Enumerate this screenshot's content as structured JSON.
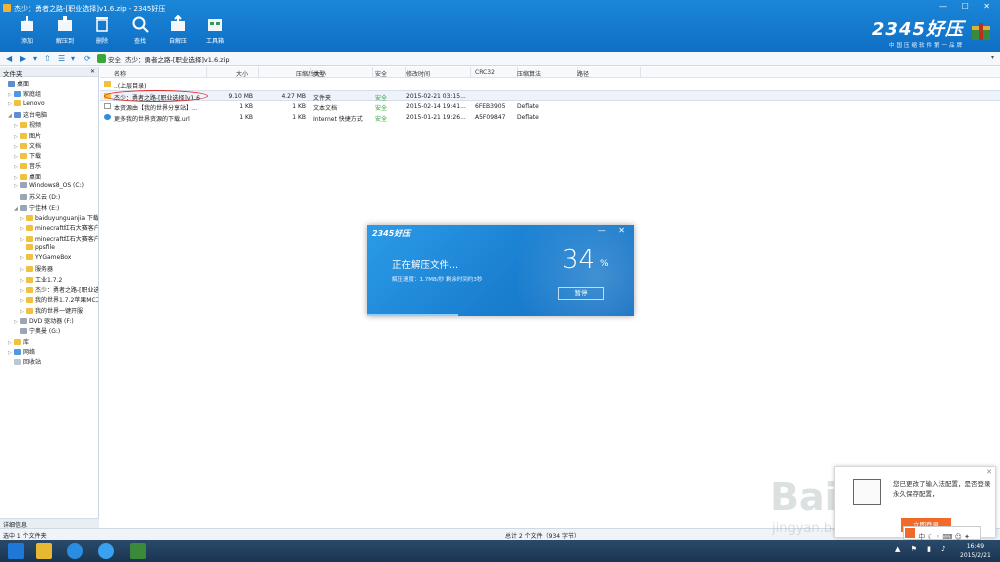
{
  "window": {
    "title": "杰少：勇者之路-[职业选择]v1.6.zip - 2345好压",
    "controls": "— ☐ ✕"
  },
  "toolbar": {
    "buttons": [
      {
        "label": "添加",
        "icon": "add-icon"
      },
      {
        "label": "解压到",
        "icon": "extract-icon"
      },
      {
        "label": "删除",
        "icon": "delete-icon"
      },
      {
        "label": "查找",
        "icon": "search-icon"
      },
      {
        "label": "自解压",
        "icon": "self-extract-icon"
      },
      {
        "label": "工具箱",
        "icon": "toolbox-icon"
      }
    ],
    "brand_title": "2345好压",
    "brand_sub": "中国压缩软件第一品牌"
  },
  "addressbar": {
    "safe_label": "安全",
    "path": "杰少：勇者之路-[职业选择]v1.6.zip"
  },
  "tree": {
    "header": "文件夹",
    "items": [
      {
        "label": "桌面",
        "level": 0,
        "type": "pc",
        "toggle": ""
      },
      {
        "label": "家庭组",
        "level": 1,
        "type": "net",
        "toggle": "▷"
      },
      {
        "label": "Lenovo",
        "level": 1,
        "type": "folder",
        "toggle": "▷"
      },
      {
        "label": "这台电脑",
        "level": 1,
        "type": "pc",
        "toggle": "◢"
      },
      {
        "label": "视频",
        "level": 2,
        "type": "folder",
        "toggle": "▷"
      },
      {
        "label": "图片",
        "level": 2,
        "type": "folder",
        "toggle": "▷"
      },
      {
        "label": "文档",
        "level": 2,
        "type": "folder",
        "toggle": "▷"
      },
      {
        "label": "下载",
        "level": 2,
        "type": "folder",
        "toggle": "▷"
      },
      {
        "label": "音乐",
        "level": 2,
        "type": "folder",
        "toggle": "▷"
      },
      {
        "label": "桌面",
        "level": 2,
        "type": "folder",
        "toggle": "▷"
      },
      {
        "label": "Windows8_OS (C:)",
        "level": 2,
        "type": "drive",
        "toggle": "▷"
      },
      {
        "label": "苏义云 (D:)",
        "level": 2,
        "type": "drive",
        "toggle": ""
      },
      {
        "label": "宁佳林 (E:)",
        "level": 2,
        "type": "drive",
        "toggle": "◢"
      },
      {
        "label": "baiduyunguanjia 下载文",
        "level": 3,
        "type": "folder",
        "toggle": "▷"
      },
      {
        "label": "minecraft红石大赛客户",
        "level": 3,
        "type": "folder",
        "toggle": "▷"
      },
      {
        "label": "minecraft红石大赛客户",
        "level": 3,
        "type": "folder",
        "toggle": "▷"
      },
      {
        "label": "ppsfile",
        "level": 3,
        "type": "folder",
        "toggle": ""
      },
      {
        "label": "YYGameBox",
        "level": 3,
        "type": "folder",
        "toggle": "▷"
      },
      {
        "label": "服务器",
        "level": 3,
        "type": "folder",
        "toggle": "▷"
      },
      {
        "label": "工业1.7.2",
        "level": 3,
        "type": "folder",
        "toggle": "▷"
      },
      {
        "label": "杰少：勇者之路-[职业选",
        "level": 3,
        "type": "folder",
        "toggle": "▷"
      },
      {
        "label": "我的世界1.7.2苹果MC工",
        "level": 3,
        "type": "folder",
        "toggle": "▷"
      },
      {
        "label": "我的世界一键开服",
        "level": 3,
        "type": "folder",
        "toggle": "▷"
      },
      {
        "label": "DVD 驱动器 (F:)",
        "level": 2,
        "type": "drive",
        "toggle": "▷"
      },
      {
        "label": "宁奥曼 (G:)",
        "level": 2,
        "type": "drive",
        "toggle": ""
      },
      {
        "label": "库",
        "level": 1,
        "type": "folder",
        "toggle": "▷"
      },
      {
        "label": "网络",
        "level": 1,
        "type": "net",
        "toggle": "▷"
      },
      {
        "label": "回收站",
        "level": 1,
        "type": "bin",
        "toggle": ""
      }
    ],
    "footer": "详细信息"
  },
  "list": {
    "columns": [
      "名称",
      "大小",
      "压缩后大小",
      "类型",
      "安全",
      "修改时间",
      "CRC32",
      "压缩算法",
      "路径"
    ],
    "rows": [
      {
        "name": "..(上层目录)",
        "size": "",
        "packed": "",
        "type": "",
        "safe": "",
        "mtime": "",
        "crc": "",
        "method": "",
        "path": "",
        "icon": "up-folder"
      },
      {
        "name": "杰少：勇者之路-[职业选择]v1.6",
        "size": "9.10 MB",
        "packed": "4.27 MB",
        "type": "文件夹",
        "safe": "安全",
        "mtime": "2015-02-21 03:15...",
        "crc": "",
        "method": "",
        "path": "",
        "icon": "folder"
      },
      {
        "name": "本资源由【我的世界分享站】...",
        "size": "1 KB",
        "packed": "1 KB",
        "type": "文本文档",
        "safe": "安全",
        "mtime": "2015-02-14 19:41...",
        "crc": "6FEB3905",
        "method": "Deflate",
        "path": "",
        "icon": "text-file"
      },
      {
        "name": "更多我的世界资源的下载.url",
        "size": "1 KB",
        "packed": "1 KB",
        "type": "Internet 快捷方式",
        "safe": "安全",
        "mtime": "2015-01-21 19:26...",
        "crc": "A5F09847",
        "method": "Deflate",
        "path": "",
        "icon": "url-file"
      }
    ]
  },
  "status": {
    "left": "选中 1 个文件夹",
    "summary": "总计 2 个文件（934 字节）"
  },
  "dialog": {
    "brand": "2345好压",
    "title": "正在解压文件...",
    "speed": "解压速度：1.7MB/秒  剩余时间约3秒",
    "percent_value": "34",
    "percent_sign": "%",
    "progress": 0.34,
    "pause": "暂停",
    "controls": "— ✕"
  },
  "toast": {
    "text": "您已更改了输入法配置，是否登录永久保存配置，",
    "button": "立即登录"
  },
  "taskbar": {
    "clock_time": "16:49",
    "clock_date": "2015/2/21"
  },
  "colors": {
    "brand_blue": "#1b86d8",
    "safe_green": "#2fa03a",
    "toast_orange": "#f06a2a"
  }
}
